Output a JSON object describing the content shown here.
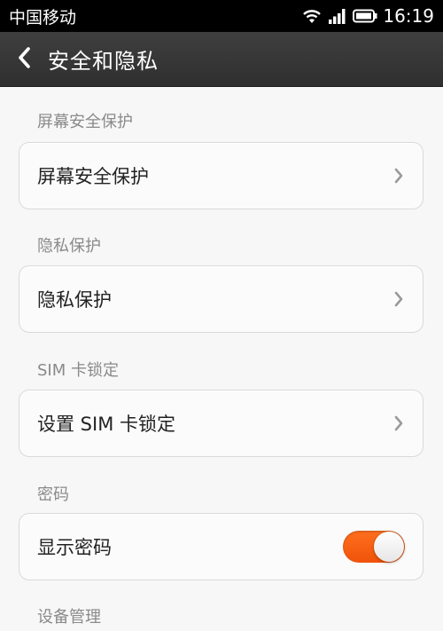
{
  "status_bar": {
    "carrier": "中国移动",
    "time": "16:19"
  },
  "header": {
    "title": "安全和隐私"
  },
  "sections": [
    {
      "header": "屏幕安全保护",
      "item_label": "屏幕安全保护",
      "control": "chevron"
    },
    {
      "header": "隐私保护",
      "item_label": "隐私保护",
      "control": "chevron"
    },
    {
      "header": "SIM 卡锁定",
      "item_label": "设置 SIM 卡锁定",
      "control": "chevron"
    },
    {
      "header": "密码",
      "item_label": "显示密码",
      "control": "toggle",
      "toggle_on": true
    },
    {
      "header": "设备管理"
    }
  ],
  "colors": {
    "toggle_on": "#f05a0e",
    "action_bar": "#353535",
    "background": "#f7f7f7"
  }
}
